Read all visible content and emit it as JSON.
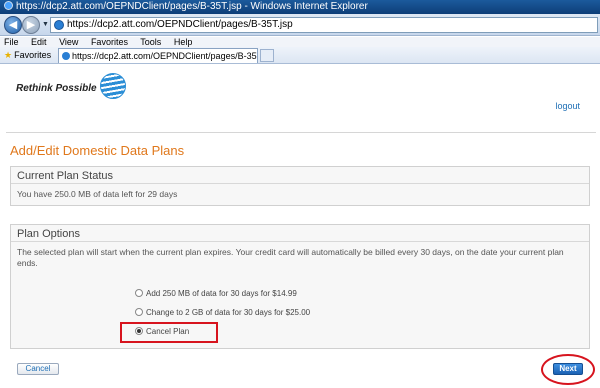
{
  "window": {
    "title": "https://dcp2.att.com/OEPNDClient/pages/B-35T.jsp - Windows Internet Explorer"
  },
  "browser": {
    "address": "https://dcp2.att.com/OEPNDClient/pages/B-35T.jsp",
    "menu": [
      "File",
      "Edit",
      "View",
      "Favorites",
      "Tools",
      "Help"
    ],
    "favorites_label": "Favorites",
    "tab_title": "https://dcp2.att.com/OEPNDClient/pages/B-35T..."
  },
  "header": {
    "brand": "Rethink Possible",
    "logout": "logout"
  },
  "main": {
    "heading": "Add/Edit Domestic Data Plans",
    "current_plan": {
      "title": "Current Plan Status",
      "status": "You have 250.0 MB of data left for 29 days"
    },
    "plan_options": {
      "title": "Plan Options",
      "description": "The selected plan will start when the current plan expires. Your credit card will automatically be billed every 30 days, on the date your current plan ends.",
      "options": [
        {
          "label": "Add 250 MB of data for 30 days for $14.99",
          "selected": false
        },
        {
          "label": "Change to 2 GB of data for 30 days for $25.00",
          "selected": false
        },
        {
          "label": "Cancel Plan",
          "selected": true
        }
      ]
    },
    "cancel_button": "Cancel",
    "next_button": "Next"
  },
  "colors": {
    "heading": "#e0781c",
    "link": "#1f6fb5",
    "highlight": "#d7141e",
    "primary_button": "#1b62b4"
  }
}
